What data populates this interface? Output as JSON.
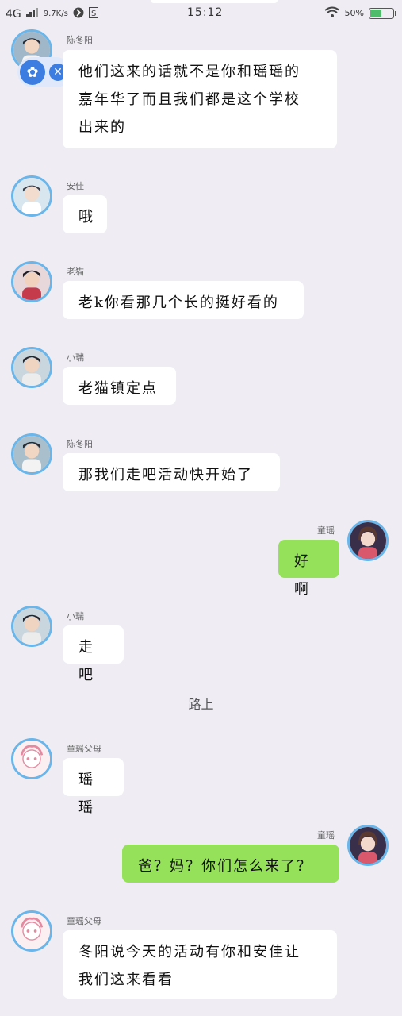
{
  "status_bar": {
    "network": "4G",
    "speed": "9.7K/s",
    "time": "15:12",
    "battery": "50%",
    "battery_level": 0.5
  },
  "messages": [
    {
      "sender": "陈冬阳",
      "text_lines": [
        "他们这来的话就不是你和瑶瑶的",
        "嘉年华了而且我们都是这个学校",
        "出来的"
      ]
    },
    {
      "sender": "安佳",
      "text_lines": [
        "哦"
      ]
    },
    {
      "sender": "老猫",
      "text_lines": [
        "老k你看那几个长的挺好看的"
      ]
    },
    {
      "sender": "小瑞",
      "text_lines": [
        "老猫镇定点"
      ]
    },
    {
      "sender": "陈冬阳",
      "text_lines": [
        "那我们走吧活动快开始了"
      ]
    },
    {
      "sender": "童瑶",
      "text_lines": [
        "好啊"
      ]
    },
    {
      "sender": "小瑞",
      "text_lines": [
        "走吧"
      ]
    },
    {
      "separator": "路上"
    },
    {
      "sender": "童瑶父母",
      "text_lines": [
        "瑶瑶"
      ]
    },
    {
      "sender": "童瑶",
      "text_lines": [
        "爸？妈？你们怎么来了？"
      ]
    },
    {
      "sender": "童瑶父母",
      "text_lines": [
        "冬阳说今天的活动有你和安佳让",
        "我们这来看看"
      ]
    }
  ],
  "colors": {
    "background": "#efedf3",
    "bubble_white": "#ffffff",
    "bubble_green": "#95e15a",
    "avatar_ring": "#6ab6ea"
  }
}
